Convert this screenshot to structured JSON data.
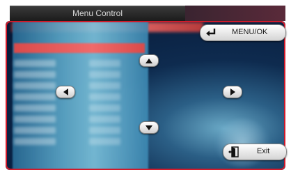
{
  "header": {
    "title": "Menu Control"
  },
  "controls": {
    "menu_ok_label": "MENU/OK",
    "exit_label": "Exit",
    "up_icon": "up-arrow-icon",
    "down_icon": "down-arrow-icon",
    "left_icon": "left-arrow-icon",
    "right_icon": "right-arrow-icon"
  },
  "colors": {
    "frame": "#d01a2a",
    "highlight": "#e06868"
  }
}
